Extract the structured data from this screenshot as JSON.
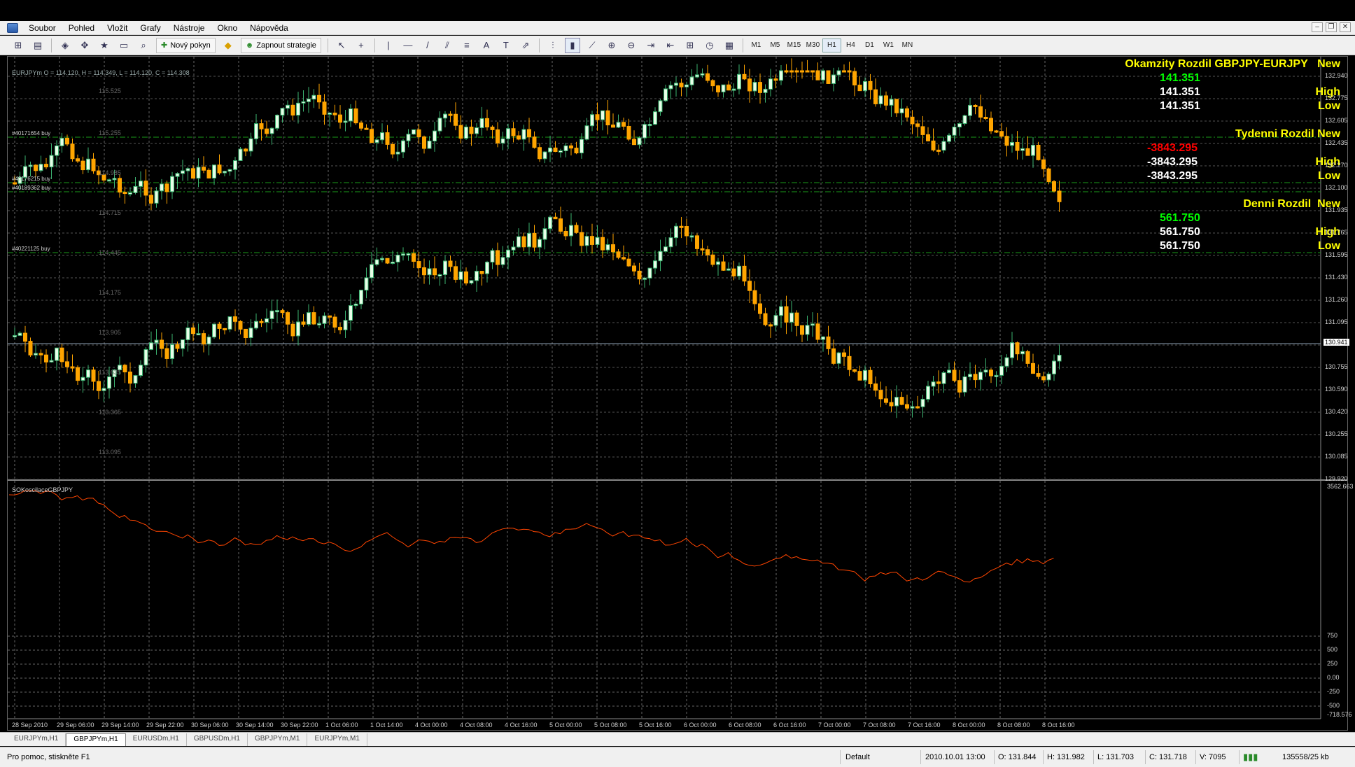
{
  "menu": [
    "Soubor",
    "Pohled",
    "Vložit",
    "Grafy",
    "Nástroje",
    "Okno",
    "Nápověda"
  ],
  "toolbar": {
    "new_order": "Nový pokyn",
    "strategies": "Zapnout strategie",
    "timeframes": [
      "M1",
      "M5",
      "M15",
      "M30",
      "H1",
      "H4",
      "D1",
      "W1",
      "MN"
    ],
    "active_timeframe": "H1"
  },
  "chart": {
    "ohlc_text": "EURJPYm O = 114.120, H = 114.349, L = 114.120, C = 114.308",
    "order_labels": [
      "#40171654 buy",
      "#40176215 buy",
      "#40189362 buy",
      "#40221125 buy"
    ],
    "inner_price_labels": [
      "115.525",
      "115.255",
      "114.985",
      "114.715",
      "114.445",
      "114.175",
      "113.905",
      "113.635",
      "113.365",
      "113.095"
    ],
    "price_axis": [
      "132.940",
      "132.775",
      "132.605",
      "132.435",
      "132.270",
      "132.100",
      "131.935",
      "131.765",
      "131.595",
      "131.430",
      "131.260",
      "131.095",
      "130.941",
      "130.755",
      "130.590",
      "130.420",
      "130.255",
      "130.085",
      "129.920"
    ],
    "current_price": "130.941",
    "indicator_name": "SOKoscilaceGBPJPY",
    "indicator_axis": [
      "3562.663",
      "750",
      "500",
      "250",
      "0.00",
      "-250",
      "-500",
      "-718.576"
    ],
    "time_axis": [
      "28 Sep 2010",
      "29 Sep 06:00",
      "29 Sep 14:00",
      "29 Sep 22:00",
      "30 Sep 06:00",
      "30 Sep 14:00",
      "30 Sep 22:00",
      "1 Oct 06:00",
      "1 Oct 14:00",
      "4 Oct 00:00",
      "4 Oct 08:00",
      "4 Oct 16:00",
      "5 Oct 00:00",
      "5 Oct 08:00",
      "5 Oct 16:00",
      "6 Oct 00:00",
      "6 Oct 08:00",
      "6 Oct 16:00",
      "7 Oct 00:00",
      "7 Oct 08:00",
      "7 Oct 16:00",
      "8 Oct 00:00",
      "8 Oct 08:00",
      "8 Oct 16:00"
    ]
  },
  "panel": {
    "okamzity_title": "Okamzity Rozdil GBPJPY-EURJPY",
    "okamzity_new": "New",
    "okamzity_value": "141.351",
    "okamzity_high": "141.351",
    "okamzity_low": "141.351",
    "tydenni_title": "Tydenni Rozdil",
    "tydenni_new": "New",
    "tydenni_value": "-3843.295",
    "tydenni_high": "-3843.295",
    "tydenni_low": "-3843.295",
    "denni_title": "Denni Rozdil",
    "denni_new": "New",
    "denni_value": "561.750",
    "denni_high": "561.750",
    "denni_low": "561.750",
    "high_label": "High",
    "low_label": "Low"
  },
  "tabs": [
    "EURJPYm,H1",
    "GBPJPYm,H1",
    "EURUSDm,H1",
    "GBPUSDm,H1",
    "GBPJPYm,M1",
    "EURJPYm,M1"
  ],
  "active_tab": "GBPJPYm,H1",
  "status": {
    "help": "Pro pomoc, stiskněte F1",
    "profile": "Default",
    "datetime": "2010.10.01 13:00",
    "open": "O: 131.844",
    "high": "H: 131.982",
    "low": "L: 131.703",
    "close": "C: 131.718",
    "volume": "V: 7095",
    "traffic": "135558/25 kb"
  },
  "colors": {
    "bull": "#3cb371",
    "bear": "#ffa500",
    "oscillator": "#ff4500",
    "green_text": "#00ff00",
    "red_text": "#ff0000",
    "yellow_text": "#ffff00"
  }
}
